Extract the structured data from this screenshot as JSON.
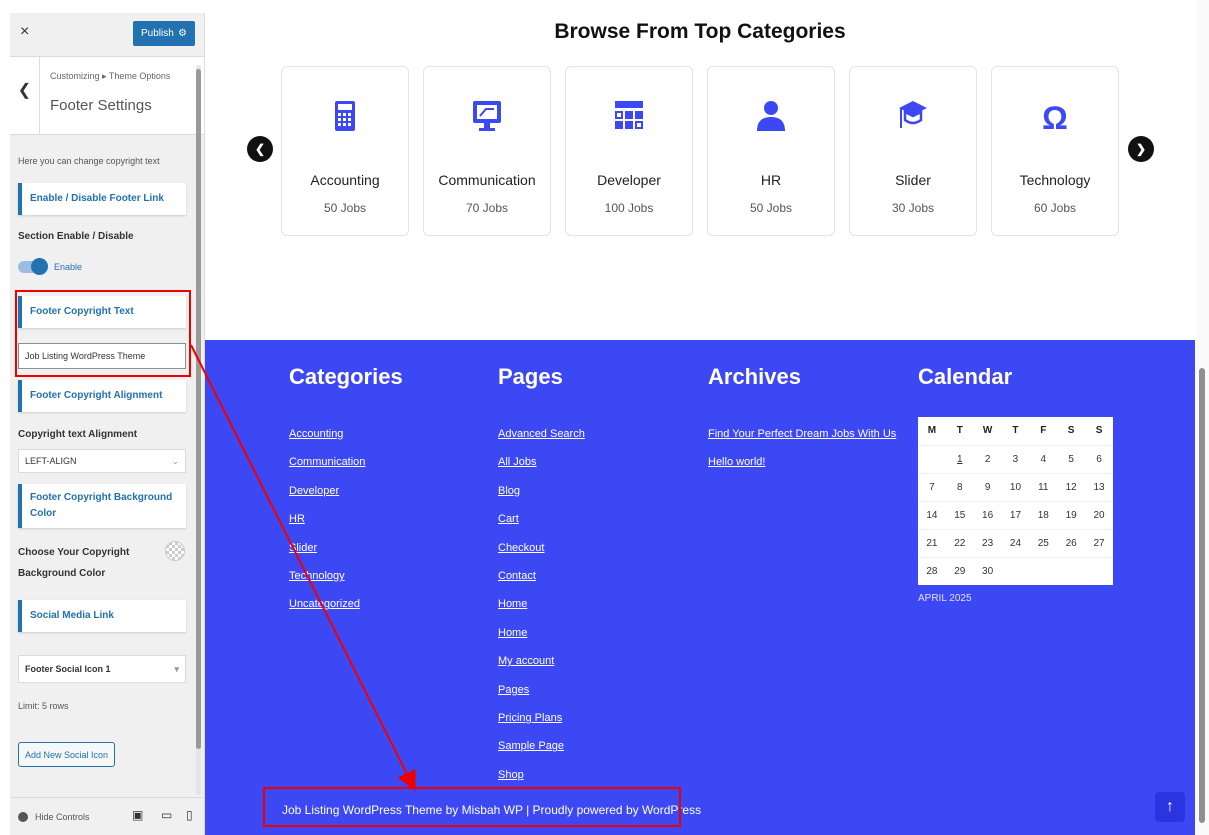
{
  "sidebar": {
    "close_icon": "×",
    "publish_label": "Publish",
    "breadcrumb": "Customizing ▸ Theme Options",
    "section_title": "Footer Settings",
    "description": "Here you can change copyright text",
    "enable_footer_link": "Enable / Disable Footer Link",
    "section_enable_label": "Section Enable / Disable",
    "toggle_label": "Enable",
    "footer_copyright_text_card": "Footer Copyright Text",
    "copyright_input_value": "Job Listing WordPress Theme",
    "footer_alignment_card": "Footer Copyright Alignment",
    "alignment_label": "Copyright text Alignment",
    "alignment_value": "LEFT-ALIGN",
    "bg_color_card": "Footer Copyright Background Color",
    "bg_color_label": "Choose Your Copyright Background Color",
    "social_media_card": "Social Media Link",
    "social_icon_select": "Footer Social Icon 1",
    "limit_text": "Limit: 5 rows",
    "add_social_button": "Add New Social Icon",
    "hide_controls": "Hide Controls"
  },
  "main": {
    "browse_title": "Browse From Top Categories",
    "categories": [
      {
        "name": "Accounting",
        "jobs": "50 Jobs",
        "icon": "calculator-icon"
      },
      {
        "name": "Communication",
        "jobs": "70 Jobs",
        "icon": "monitor-icon"
      },
      {
        "name": "Developer",
        "jobs": "100 Jobs",
        "icon": "grid-icon"
      },
      {
        "name": "HR",
        "jobs": "50 Jobs",
        "icon": "user-icon"
      },
      {
        "name": "Slider",
        "jobs": "30 Jobs",
        "icon": "graduation-cap-icon"
      },
      {
        "name": "Technology",
        "jobs": "60 Jobs",
        "icon": "omega-icon"
      }
    ],
    "accent_color": "#3d48f5"
  },
  "footer": {
    "categories_title": "Categories",
    "categories_links": [
      "Accounting",
      "Communication",
      "Developer",
      "HR",
      "Slider",
      "Technology",
      "Uncategorized"
    ],
    "pages_title": "Pages",
    "pages_links": [
      "Advanced Search",
      "All Jobs",
      "Blog",
      "Cart",
      "Checkout",
      "Contact",
      "Home",
      "Home",
      "My account",
      "Pages",
      "Pricing Plans",
      "Sample Page",
      "Shop"
    ],
    "archives_title": "Archives",
    "archives_links": [
      "Find Your Perfect Dream Jobs With Us",
      "Hello world!"
    ],
    "calendar_title": "Calendar",
    "calendar_days": [
      "M",
      "T",
      "W",
      "T",
      "F",
      "S",
      "S"
    ],
    "calendar_rows": [
      [
        "",
        "1",
        "2",
        "3",
        "4",
        "5",
        "6"
      ],
      [
        "7",
        "8",
        "9",
        "10",
        "11",
        "12",
        "13"
      ],
      [
        "14",
        "15",
        "16",
        "17",
        "18",
        "19",
        "20"
      ],
      [
        "21",
        "22",
        "23",
        "24",
        "25",
        "26",
        "27"
      ],
      [
        "28",
        "29",
        "30",
        "",
        "",
        "",
        ""
      ]
    ],
    "calendar_month": "APRIL 2025",
    "copyright": "Job Listing WordPress Theme by Misbah WP | Proudly powered by WordPress"
  }
}
